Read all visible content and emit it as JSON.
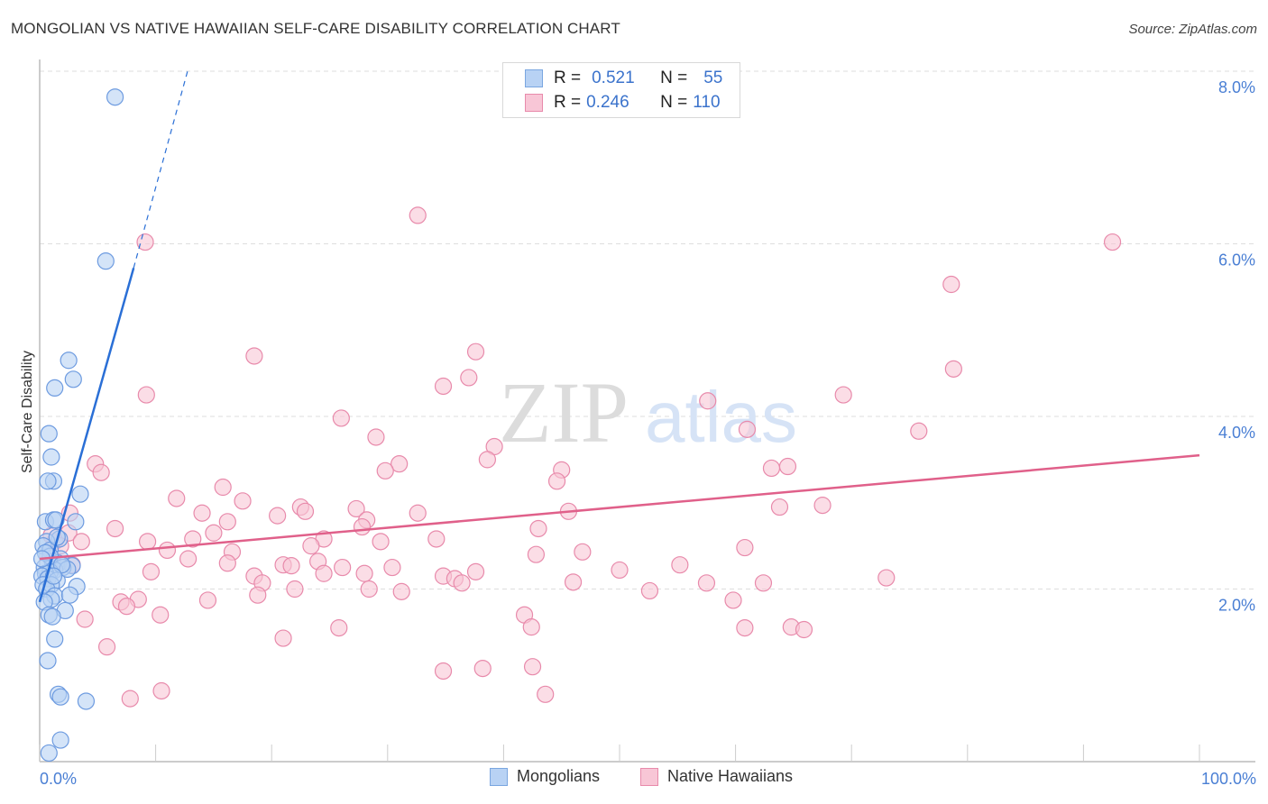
{
  "title": "MONGOLIAN VS NATIVE HAWAIIAN SELF-CARE DISABILITY CORRELATION CHART",
  "source": "Source: ZipAtlas.com",
  "watermark": {
    "zip": "ZIP",
    "atlas": "atlas"
  },
  "legend": {
    "rows": [
      {
        "r_label": "R =",
        "r_value": "0.521",
        "n_label": "N =",
        "n_value": "55",
        "color": "#b8d2f4",
        "border": "#7aa6e0"
      },
      {
        "r_label": "R =",
        "r_value": "0.246",
        "n_label": "N =",
        "n_value": "110",
        "color": "#f8c6d6",
        "border": "#e88aab"
      }
    ]
  },
  "bottom_legend": [
    {
      "label": "Mongolians",
      "color": "#b8d2f4",
      "border": "#7aa6e0"
    },
    {
      "label": "Native Hawaiians",
      "color": "#f8c6d6",
      "border": "#e88aab"
    }
  ],
  "chart_data": {
    "type": "scatter",
    "title": "MONGOLIAN VS NATIVE HAWAIIAN SELF-CARE DISABILITY CORRELATION CHART",
    "xlabel": "",
    "ylabel": "Self-Care Disability",
    "xlim": [
      0,
      100
    ],
    "ylim": [
      0,
      8.0
    ],
    "x_tick_labels": [
      "0.0%",
      "100.0%"
    ],
    "x_minor_ticks": [
      0,
      10,
      20,
      30,
      40,
      50,
      60,
      70,
      80,
      90,
      100
    ],
    "y_ticks": [
      2.0,
      4.0,
      6.0,
      8.0
    ],
    "y_tick_labels": [
      "2.0%",
      "4.0%",
      "6.0%",
      "8.0%"
    ],
    "grid": "horizontal-dashed",
    "legend_position": "top-center",
    "series": [
      {
        "name": "Mongolians",
        "R": 0.521,
        "N": 55,
        "color": "#b8d2f4",
        "edge": "#6d9be0",
        "trend_color": "#2a6fd6",
        "trend": {
          "x0": 0,
          "y0": 1.85,
          "x1": 8.1,
          "y1": 5.72,
          "dash_to_x": 12.75,
          "dash_to_y": 8.0
        },
        "points": [
          [
            6.5,
            7.7
          ],
          [
            5.7,
            5.8
          ],
          [
            2.5,
            4.65
          ],
          [
            2.9,
            4.43
          ],
          [
            1.3,
            4.33
          ],
          [
            0.8,
            3.8
          ],
          [
            1.0,
            3.53
          ],
          [
            1.2,
            3.25
          ],
          [
            0.7,
            3.25
          ],
          [
            3.5,
            3.1
          ],
          [
            0.5,
            2.78
          ],
          [
            1.2,
            2.8
          ],
          [
            1.4,
            2.8
          ],
          [
            3.1,
            2.78
          ],
          [
            1.7,
            2.58
          ],
          [
            0.6,
            2.55
          ],
          [
            0.3,
            2.5
          ],
          [
            0.9,
            2.45
          ],
          [
            1.8,
            2.35
          ],
          [
            1.1,
            2.32
          ],
          [
            1.6,
            2.3
          ],
          [
            2.8,
            2.27
          ],
          [
            0.4,
            2.25
          ],
          [
            2.0,
            2.25
          ],
          [
            1.3,
            2.22
          ],
          [
            0.9,
            2.2
          ],
          [
            0.5,
            2.18
          ],
          [
            0.2,
            2.15
          ],
          [
            0.7,
            2.12
          ],
          [
            1.5,
            2.1
          ],
          [
            0.3,
            2.05
          ],
          [
            1.0,
            2.05
          ],
          [
            3.2,
            2.03
          ],
          [
            0.6,
            2.0
          ],
          [
            1.3,
            1.92
          ],
          [
            1.0,
            1.88
          ],
          [
            0.4,
            1.85
          ],
          [
            2.2,
            1.75
          ],
          [
            0.8,
            1.7
          ],
          [
            1.1,
            1.68
          ],
          [
            1.3,
            1.42
          ],
          [
            0.7,
            1.17
          ],
          [
            1.6,
            0.78
          ],
          [
            1.8,
            0.75
          ],
          [
            4.0,
            0.7
          ],
          [
            1.8,
            0.25
          ],
          [
            0.8,
            0.1
          ],
          [
            1.5,
            2.6
          ],
          [
            0.9,
            2.38
          ],
          [
            2.4,
            2.23
          ],
          [
            0.5,
            2.42
          ],
          [
            1.9,
            2.28
          ],
          [
            0.2,
            2.35
          ],
          [
            1.2,
            2.15
          ],
          [
            2.6,
            1.93
          ]
        ]
      },
      {
        "name": "Native Hawaiians",
        "R": 0.246,
        "N": 110,
        "color": "#f8c6d6",
        "edge": "#e88aab",
        "trend_color": "#e0608a",
        "trend": {
          "x0": 0,
          "y0": 2.35,
          "x1": 100,
          "y1": 3.55
        },
        "points": [
          [
            9.1,
            6.02
          ],
          [
            32.6,
            6.33
          ],
          [
            92.5,
            6.02
          ],
          [
            78.6,
            5.53
          ],
          [
            18.5,
            4.7
          ],
          [
            37.6,
            4.75
          ],
          [
            37.0,
            4.45
          ],
          [
            34.8,
            4.35
          ],
          [
            9.2,
            4.25
          ],
          [
            78.8,
            4.55
          ],
          [
            69.3,
            4.25
          ],
          [
            57.6,
            4.18
          ],
          [
            26.0,
            3.98
          ],
          [
            29.0,
            3.76
          ],
          [
            75.8,
            3.83
          ],
          [
            61.0,
            3.85
          ],
          [
            39.2,
            3.65
          ],
          [
            38.6,
            3.5
          ],
          [
            31.0,
            3.45
          ],
          [
            29.8,
            3.37
          ],
          [
            45.0,
            3.38
          ],
          [
            63.1,
            3.4
          ],
          [
            64.5,
            3.42
          ],
          [
            4.8,
            3.45
          ],
          [
            5.3,
            3.35
          ],
          [
            44.6,
            3.25
          ],
          [
            15.8,
            3.18
          ],
          [
            11.8,
            3.05
          ],
          [
            17.5,
            3.02
          ],
          [
            22.5,
            2.95
          ],
          [
            27.3,
            2.93
          ],
          [
            63.8,
            2.95
          ],
          [
            67.5,
            2.97
          ],
          [
            20.5,
            2.85
          ],
          [
            14.0,
            2.88
          ],
          [
            2.6,
            2.88
          ],
          [
            22.9,
            2.9
          ],
          [
            32.6,
            2.88
          ],
          [
            45.6,
            2.9
          ],
          [
            16.2,
            2.78
          ],
          [
            28.2,
            2.8
          ],
          [
            27.8,
            2.72
          ],
          [
            6.5,
            2.7
          ],
          [
            43.0,
            2.7
          ],
          [
            9.3,
            2.55
          ],
          [
            2.5,
            2.65
          ],
          [
            15.0,
            2.65
          ],
          [
            13.2,
            2.58
          ],
          [
            24.5,
            2.58
          ],
          [
            29.4,
            2.55
          ],
          [
            1.3,
            2.55
          ],
          [
            34.2,
            2.58
          ],
          [
            11.0,
            2.45
          ],
          [
            16.6,
            2.43
          ],
          [
            23.4,
            2.5
          ],
          [
            42.8,
            2.4
          ],
          [
            46.8,
            2.43
          ],
          [
            60.8,
            2.48
          ],
          [
            12.8,
            2.35
          ],
          [
            2.8,
            2.28
          ],
          [
            21.0,
            2.28
          ],
          [
            16.2,
            2.3
          ],
          [
            24.0,
            2.32
          ],
          [
            21.7,
            2.27
          ],
          [
            26.1,
            2.25
          ],
          [
            30.4,
            2.25
          ],
          [
            9.6,
            2.2
          ],
          [
            24.5,
            2.18
          ],
          [
            37.6,
            2.2
          ],
          [
            50.0,
            2.22
          ],
          [
            18.5,
            2.15
          ],
          [
            28.0,
            2.18
          ],
          [
            34.8,
            2.15
          ],
          [
            35.8,
            2.12
          ],
          [
            36.4,
            2.07
          ],
          [
            55.2,
            2.28
          ],
          [
            46.0,
            2.08
          ],
          [
            57.5,
            2.07
          ],
          [
            62.4,
            2.07
          ],
          [
            73.0,
            2.13
          ],
          [
            19.2,
            2.07
          ],
          [
            22.0,
            2.0
          ],
          [
            28.4,
            2.0
          ],
          [
            31.2,
            1.97
          ],
          [
            52.6,
            1.98
          ],
          [
            14.5,
            1.87
          ],
          [
            18.8,
            1.93
          ],
          [
            8.5,
            1.88
          ],
          [
            7.0,
            1.85
          ],
          [
            7.5,
            1.8
          ],
          [
            59.8,
            1.87
          ],
          [
            10.4,
            1.7
          ],
          [
            3.9,
            1.65
          ],
          [
            41.8,
            1.7
          ],
          [
            42.4,
            1.56
          ],
          [
            25.8,
            1.55
          ],
          [
            60.8,
            1.55
          ],
          [
            64.8,
            1.56
          ],
          [
            65.9,
            1.53
          ],
          [
            21.0,
            1.43
          ],
          [
            5.8,
            1.33
          ],
          [
            34.8,
            1.05
          ],
          [
            38.2,
            1.08
          ],
          [
            42.5,
            1.1
          ],
          [
            43.6,
            0.78
          ],
          [
            10.5,
            0.82
          ],
          [
            7.8,
            0.73
          ],
          [
            1.8,
            2.5
          ],
          [
            1.0,
            2.62
          ],
          [
            3.6,
            2.55
          ]
        ]
      }
    ]
  }
}
